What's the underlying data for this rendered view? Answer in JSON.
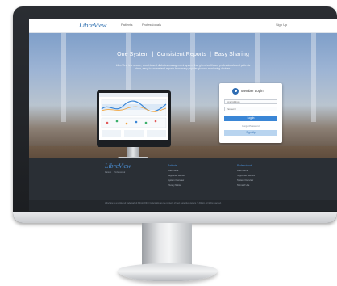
{
  "nav": {
    "logo": "LibreView",
    "links": [
      "Patients",
      "Professionals"
    ],
    "signup": "Sign Up"
  },
  "hero": {
    "headline": "One System  |  Consistent Reports  |  Easy Sharing",
    "subtext": "LibreView is a secure, cloud-based diabetes management system that gives healthcare professionals and patients clear, easy-to-understand reports from many popular glucose monitoring devices."
  },
  "login": {
    "title": "Member Login",
    "email_placeholder": "Email Address",
    "password_placeholder": "Password",
    "login_label": "Log In",
    "forgot_label": "Forgot Password",
    "signup_label": "Sign Up"
  },
  "footer": {
    "logo": "LibreView",
    "tagline": "Patient    Professional",
    "patients_head": "Patients",
    "patients_links": [
      "Learn More",
      "Supported Devices",
      "System Overview",
      "Privacy Notice"
    ],
    "professionals_head": "Professionals",
    "professionals_links": [
      "Learn More",
      "Supported Devices",
      "System Overview",
      "Terms of Use"
    ],
    "copyright": "LibreView is a registered trademark of Abbott. Other trademarks are the property of their respective owners. © Abbott. All rights reserved."
  },
  "colors": {
    "brand_blue": "#2d6fb0",
    "button_blue": "#3a86d6",
    "footer_dark": "#2a2f35"
  }
}
